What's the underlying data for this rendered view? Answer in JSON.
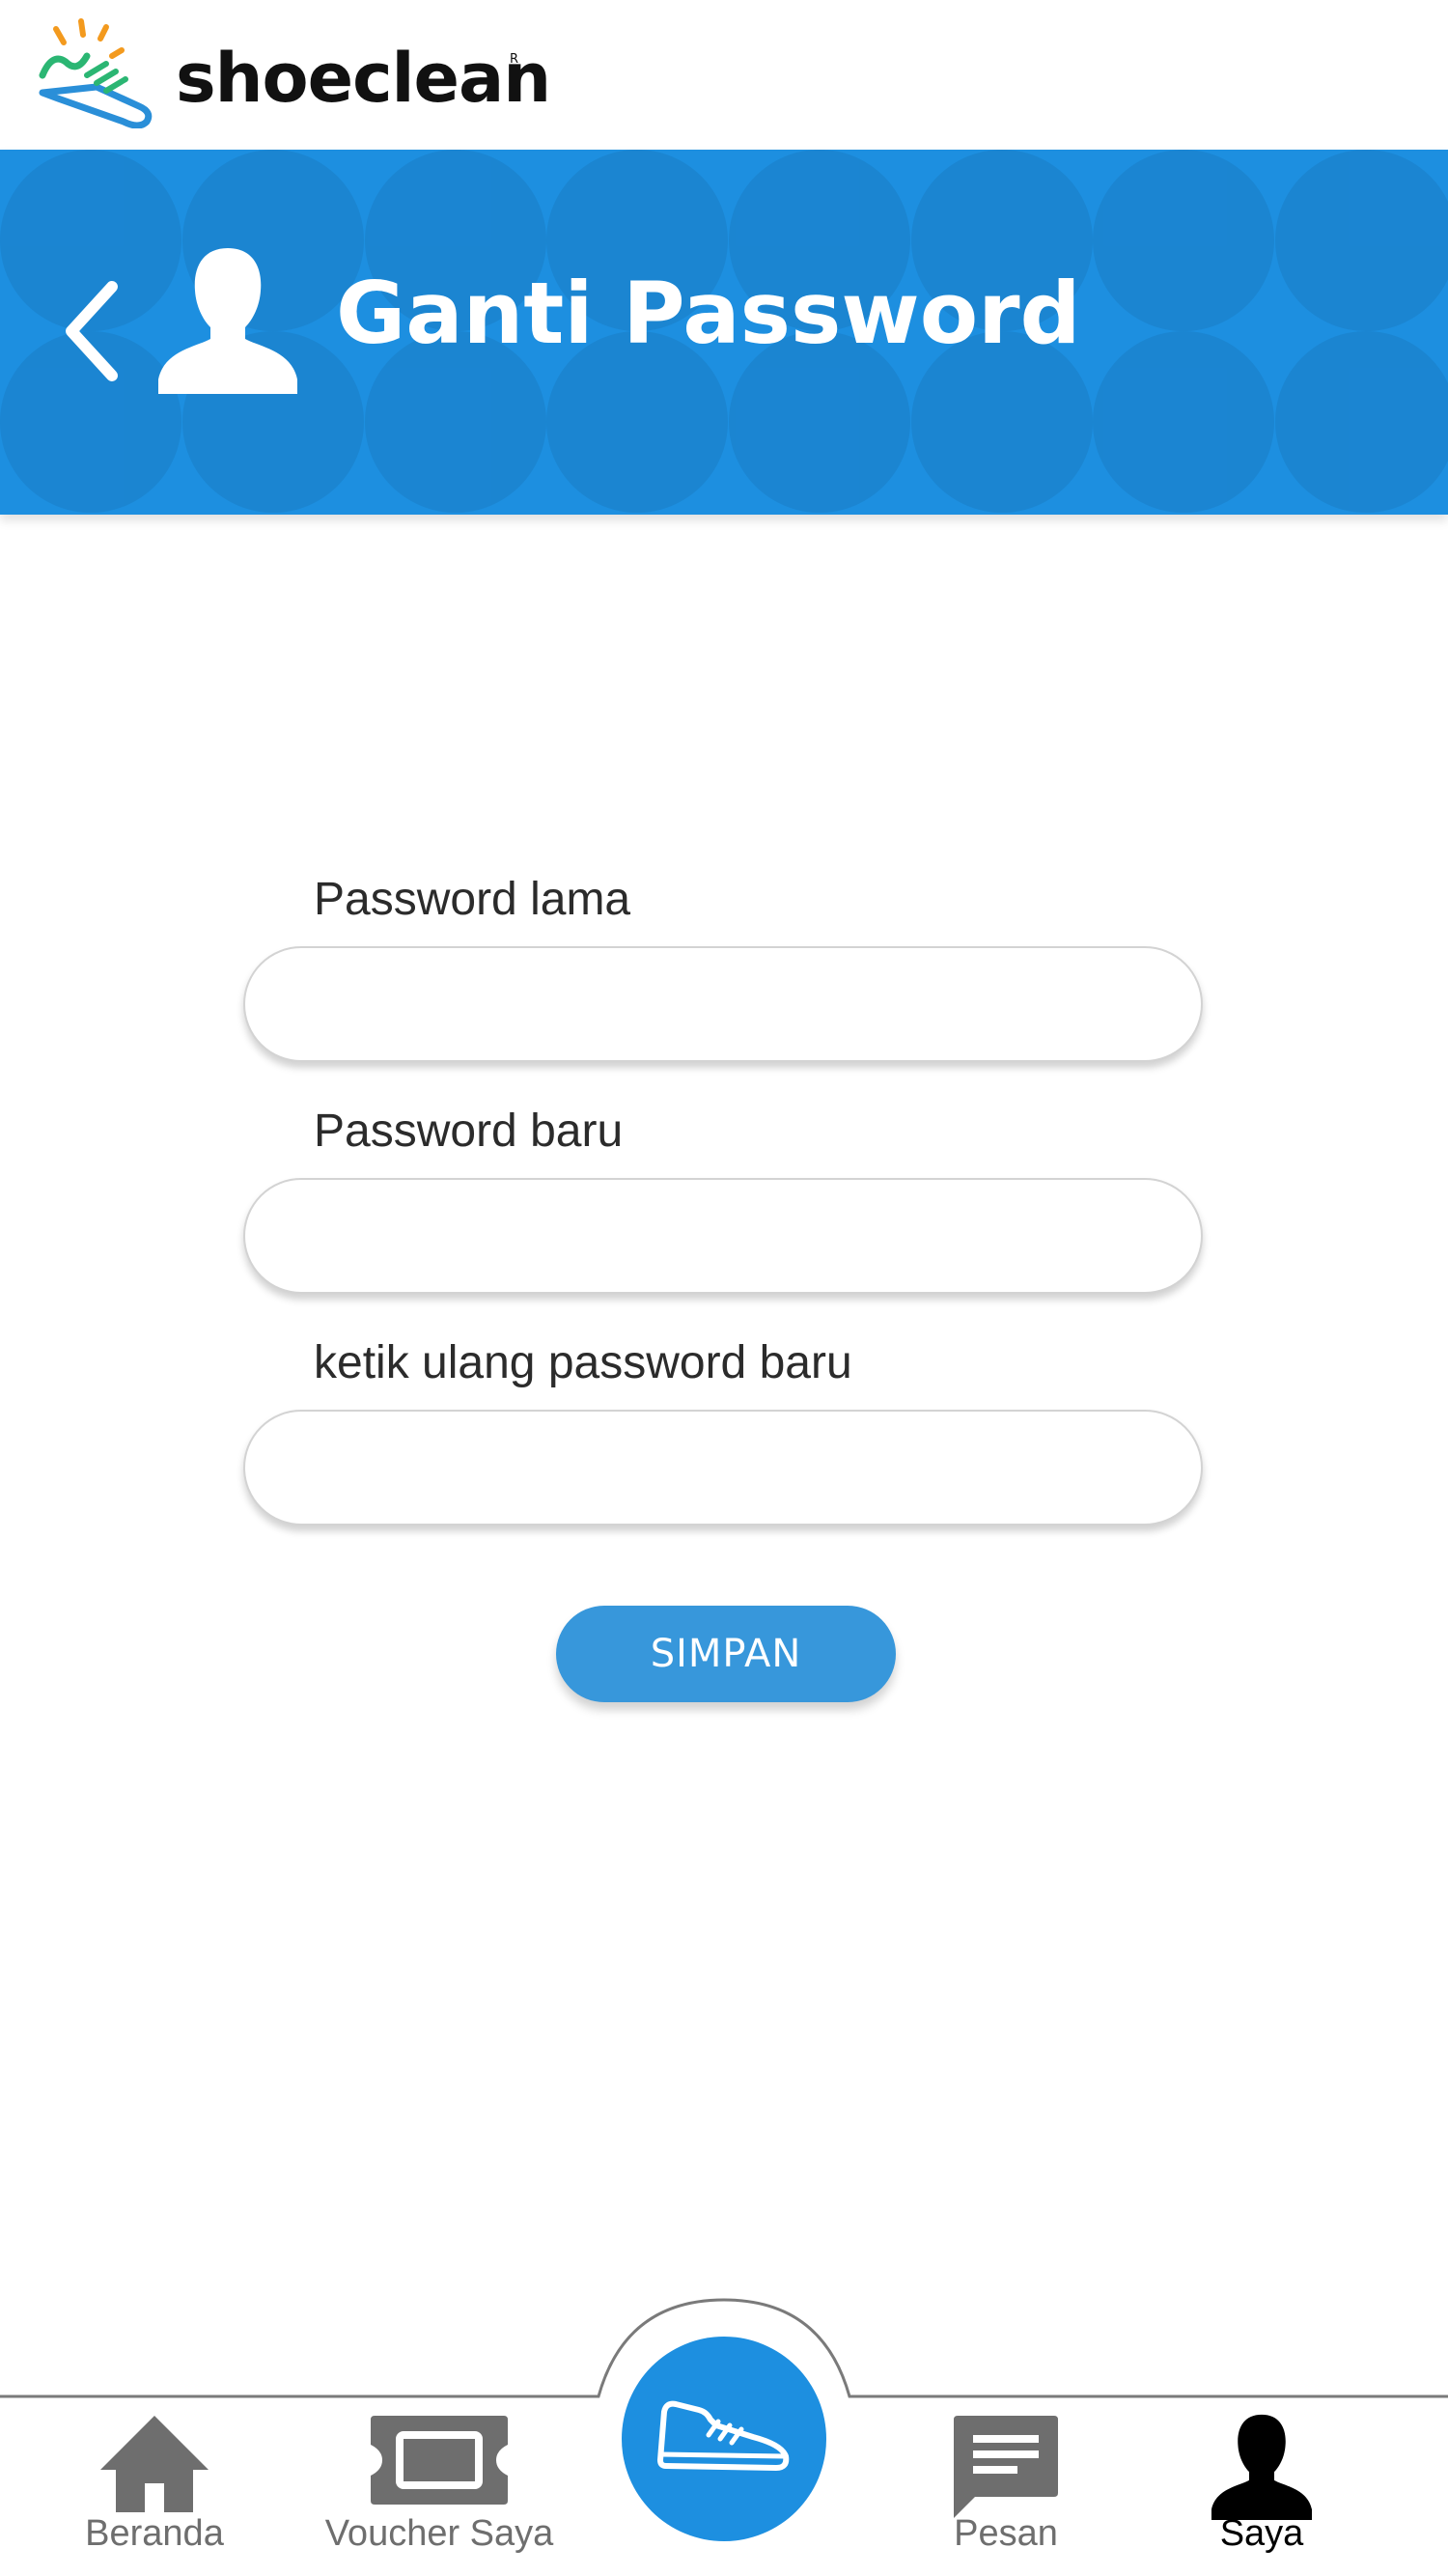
{
  "app": {
    "brand_name": "shoeclean",
    "brand_mark": "R"
  },
  "header": {
    "title": "Ganti Password",
    "back_icon": "chevron-left-icon",
    "profile_icon": "user-silhouette-icon",
    "banner_color": "#1d8fe0"
  },
  "form": {
    "old_password": {
      "label": "Password lama",
      "value": "",
      "placeholder": ""
    },
    "new_password": {
      "label": "Password baru",
      "value": "",
      "placeholder": ""
    },
    "confirm_password": {
      "label": "ketik ulang password baru",
      "value": "",
      "placeholder": ""
    },
    "save_label": "SIMPAN",
    "save_color": "#3797db"
  },
  "bottom_nav": {
    "items": [
      {
        "label": "Beranda",
        "icon": "home-icon",
        "active": false
      },
      {
        "label": "Voucher Saya",
        "icon": "ticket-icon",
        "active": false
      },
      {
        "label": "",
        "icon": "shoe-icon",
        "active": false
      },
      {
        "label": "Pesan",
        "icon": "message-icon",
        "active": false
      },
      {
        "label": "Saya",
        "icon": "user-icon",
        "active": true
      }
    ],
    "inactive_color": "#6e6e6e",
    "active_color": "#000000"
  }
}
